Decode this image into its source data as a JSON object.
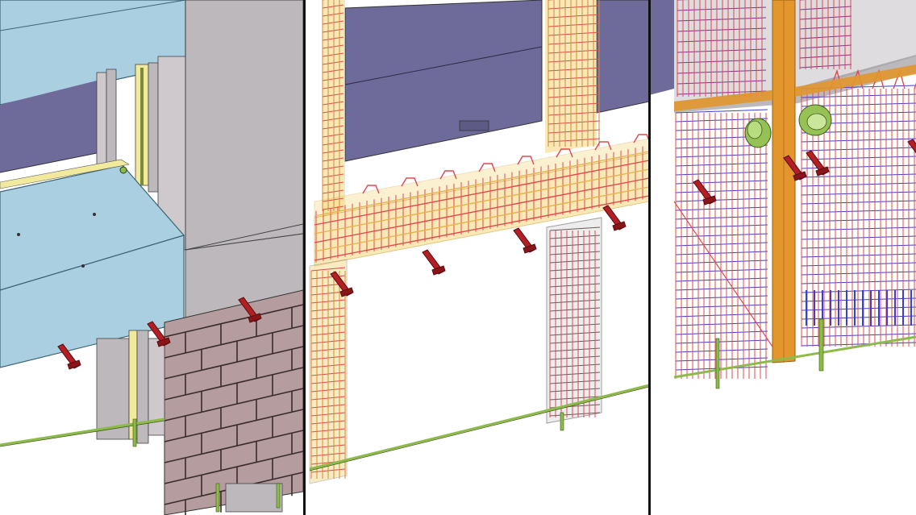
{
  "scene": {
    "panels": [
      {
        "id": "shaded",
        "mode": "shaded-model"
      },
      {
        "id": "transparent",
        "mode": "transparent-model-with-rebar"
      },
      {
        "id": "rebar",
        "mode": "rebar-only"
      }
    ],
    "colors": {
      "background": "#ffffff",
      "panel_divider": "#111111",
      "precast_slab": "#a9cfe0",
      "precast_slab_edge": "#5f8ea3",
      "column_concrete": "#bdb8bc",
      "wall_concrete": "#cfc8cc",
      "window_glass": "#6e6a9a",
      "brick_cladding": "#b59c9e",
      "brick_mortar": "#4a3b3d",
      "insulation": "#f1ea9c",
      "corbel_steel": "#b21f24",
      "anchor_bar_green": "#8dbb4a",
      "sleeve_green": "#96c255",
      "rebar_red": "#e0484e",
      "rebar_blue": "#3b3fd1",
      "rebar_purple": "#8e2f8a",
      "embed_orange": "#e2962c",
      "transparent_yellow": "#f6d77a"
    },
    "icons": [
      "corbel-icon",
      "anchor-bar-icon",
      "sleeve-icon"
    ]
  }
}
